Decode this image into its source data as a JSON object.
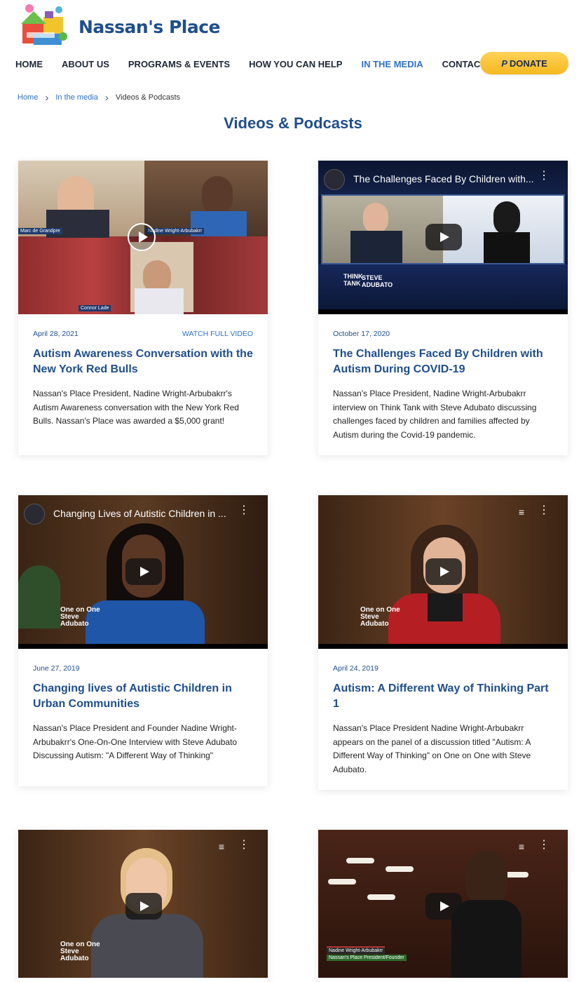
{
  "site": {
    "name": "Nassan's Place"
  },
  "nav": {
    "items": [
      "HOME",
      "ABOUT US",
      "PROGRAMS & EVENTS",
      "HOW YOU CAN HELP",
      "IN THE MEDIA",
      "CONTACT US"
    ],
    "active": "IN THE MEDIA",
    "donate_label": "DONATE"
  },
  "breadcrumb": {
    "home": "Home",
    "section": "In the media",
    "current": "Videos & Podcasts"
  },
  "page": {
    "title": "Videos & Podcasts"
  },
  "cards": [
    {
      "date": "April 28, 2021",
      "watch_label": "WATCH FULL VIDEO",
      "title": "Autism Awareness Conversation with the New York Red Bulls",
      "description": "Nassan's Place President, Nadine Wright-Arbubakrr's Autism Awareness conversation with the New York Red Bulls.  Nassan's Place was awarded a $5,000 grant!",
      "video_title": ""
    },
    {
      "date": "October 17, 2020",
      "title": "The Challenges Faced By Children with Autism During COVID-19",
      "description": "Nassan's Place President, Nadine Wright-Arbubakrr interview on Think Tank with Steve Adubato discussing challenges faced by children and families affected by Autism during the Covid-19 pandemic.",
      "video_title": "The Challenges Faced By Children with..."
    },
    {
      "date": "June 27, 2019",
      "title": "Changing lives of Autistic Children in Urban Communities",
      "description": "Nassan's Place President and Founder Nadine Wright-Arbubakrr's One-On-One Interview with Steve Adubato Discussing Autism:  \"A Different Way of Thinking\"",
      "video_title": "Changing Lives of Autistic Children in ..."
    },
    {
      "date": "April 24, 2019",
      "title": "Autism: A Different Way of Thinking Part 1",
      "description": "Nassan's Place President Nadine Wright-Arbubakrr appears on the panel of a discussion titled \"Autism: A Different Way of Thinking\" on One on One with Steve Adubato.",
      "video_title": ""
    }
  ],
  "video_labels": {
    "card1_name1": "Marc de Grandpre",
    "card1_name2": "Nadine Wright-Arbubakrr",
    "card1_name3": "Connor Lade",
    "card2_logo_line1": "THINK",
    "card2_logo_line2": "TANK",
    "card2_logo_line3": "STEVE",
    "card2_logo_line4": "ADUBATO",
    "show_line1": "One on One",
    "show_line2": "Steve",
    "show_line3": "Adubato",
    "card6_caption1": "Nadine Wright-Arbubakrr",
    "card6_caption2": "Nassan's Place President/Founder"
  }
}
